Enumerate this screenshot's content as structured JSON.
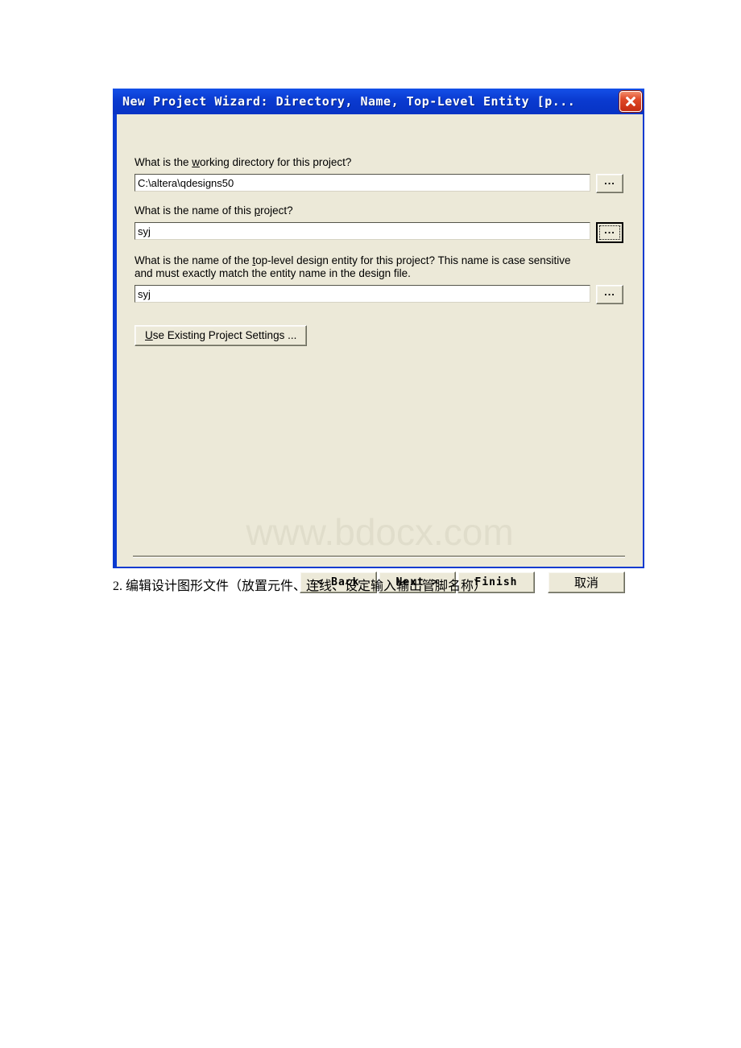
{
  "dialog": {
    "title": "New Project Wizard: Directory, Name, Top-Level Entity [p...",
    "close_icon": "close-icon",
    "fields": [
      {
        "label_before": "What is the ",
        "label_accel": "w",
        "label_after": "orking directory for this project?",
        "value": "C:\\altera\\qdesigns50",
        "browse_label": "...",
        "browse_default": false
      },
      {
        "label_before": "What is the name of this ",
        "label_accel": "p",
        "label_after": "roject?",
        "value": "syj",
        "browse_label": "...",
        "browse_default": true
      },
      {
        "label_before": "What is the name of the ",
        "label_accel": "t",
        "label_after": "op-level design entity for this project? This name is case sensitive\nand must exactly match the entity name in the design file.",
        "value": "syj",
        "browse_label": "...",
        "browse_default": false
      }
    ],
    "settings_button": {
      "accel": "U",
      "rest": "se Existing Project Settings ..."
    },
    "watermark": "www.bdocx.com",
    "footer_buttons": [
      {
        "label": "< Back"
      },
      {
        "label": "Next >"
      },
      {
        "label": "Finish"
      },
      {
        "label": "取消"
      }
    ]
  },
  "caption": "2. 编辑设计图形文件（放置元件、连线、设定输入输出管脚名称）",
  "colors": {
    "titlebar": "#0a3ad0",
    "dialog_bg": "#ece9d8",
    "close_button": "#c62d12",
    "watermark": "#e0ddcb",
    "text": "#000000"
  }
}
